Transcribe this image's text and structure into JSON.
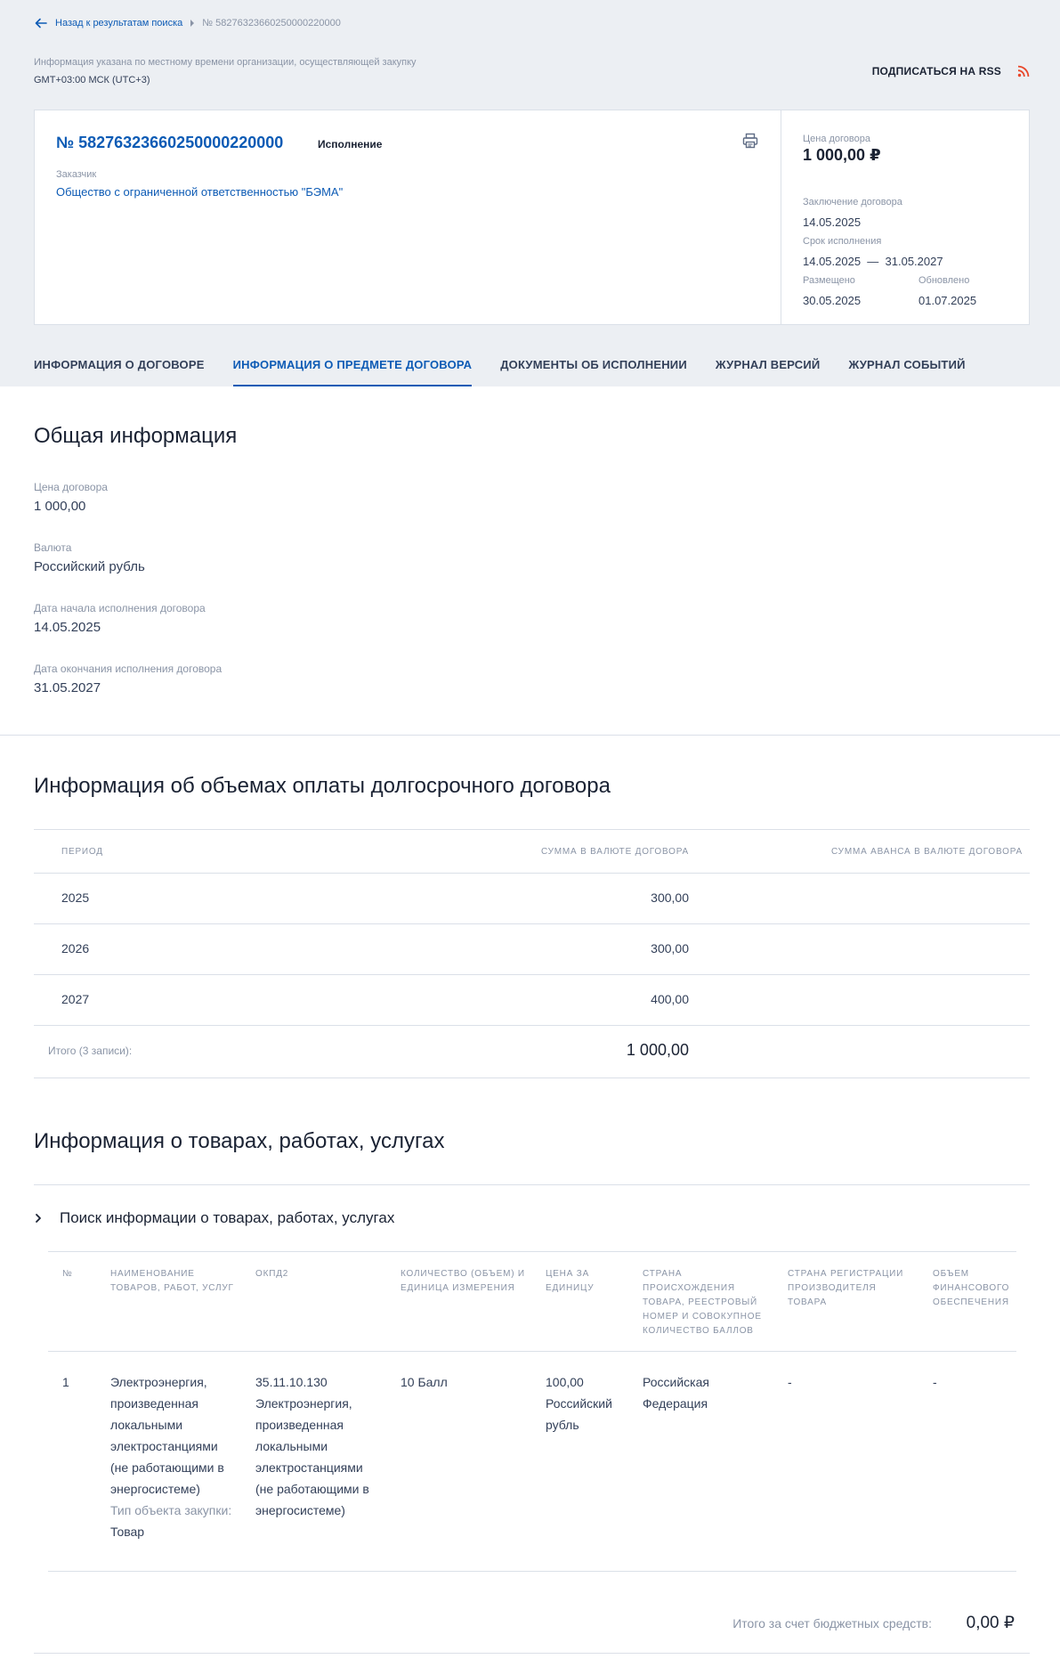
{
  "breadcrumb": {
    "back_label": "Назад к результатам поиска",
    "current": "№ 58276323660250000220000"
  },
  "timezone": {
    "note": "Информация указана по местному времени организации, осуществляющей закупку",
    "value": "GMT+03:00 МСК (UTC+3)"
  },
  "rss": {
    "label": "ПОДПИСАТЬСЯ НА RSS",
    "icon": "rss-icon"
  },
  "card": {
    "number": "№ 58276323660250000220000",
    "status": "Исполнение",
    "customer_label": "Заказчик",
    "customer_value": "Общество с ограниченной ответственностью \"БЭМА\"",
    "print_icon": "printer-icon",
    "price_label": "Цена договора",
    "price_value": "1 000,00 ₽",
    "conclusion_label": "Заключение договора",
    "conclusion_value": "14.05.2025",
    "term_label": "Срок исполнения",
    "term_value": "14.05.2025  —  31.05.2027",
    "posted_label": "Размещено",
    "posted_value": "30.05.2025",
    "updated_label": "Обновлено",
    "updated_value": "01.07.2025"
  },
  "tabs": [
    {
      "label": "ИНФОРМАЦИЯ О ДОГОВОРЕ",
      "active": false
    },
    {
      "label": "ИНФОРМАЦИЯ О ПРЕДМЕТЕ ДОГОВОРА",
      "active": true
    },
    {
      "label": "ДОКУМЕНТЫ ОБ ИСПОЛНЕНИИ",
      "active": false
    },
    {
      "label": "ЖУРНАЛ ВЕРСИЙ",
      "active": false
    },
    {
      "label": "ЖУРНАЛ СОБЫТИЙ",
      "active": false
    }
  ],
  "general": {
    "title": "Общая информация",
    "fields": [
      {
        "label": "Цена договора",
        "value": "1 000,00"
      },
      {
        "label": "Валюта",
        "value": "Российский рубль"
      },
      {
        "label": "Дата начала исполнения договора",
        "value": "14.05.2025"
      },
      {
        "label": "Дата окончания исполнения договора",
        "value": "31.05.2027"
      }
    ]
  },
  "payments": {
    "title": "Информация об объемах оплаты долгосрочного договора",
    "headers": [
      "ПЕРИОД",
      "СУММА В ВАЛЮТЕ ДОГОВОРА",
      "СУММА АВАНСА В ВАЛЮТЕ ДОГОВОРА"
    ],
    "rows": [
      {
        "period": "2025",
        "amount": "300,00",
        "advance": ""
      },
      {
        "period": "2026",
        "amount": "300,00",
        "advance": ""
      },
      {
        "period": "2027",
        "amount": "400,00",
        "advance": ""
      }
    ],
    "total_label": "Итого (3 записи):",
    "total_value": "1 000,00"
  },
  "goods": {
    "title": "Информация о товарах, работах, услугах",
    "search_label": "Поиск информации о товарах, работах, услугах",
    "headers": [
      "№",
      "НАИМЕНОВАНИЕ ТОВАРОВ, РАБОТ, УСЛУГ",
      "ОКПД2",
      "КОЛИЧЕСТВО (ОБЪЕМ) И ЕДИНИЦА ИЗМЕРЕНИЯ",
      "ЦЕНА ЗА ЕДИНИЦУ",
      "СТРАНА ПРОИСХОЖДЕНИЯ ТОВАРА, РЕЕСТРОВЫЙ НОМЕР И СОВОКУПНОЕ КОЛИЧЕСТВО БАЛЛОВ",
      "СТРАНА РЕГИСТРАЦИИ ПРОИЗВОДИТЕЛЯ ТОВАРА",
      "ОБЪЕМ ФИНАНСОВОГО ОБЕСПЕЧЕНИЯ"
    ],
    "row": {
      "num": "1",
      "name": "Электроэнергия, произведенная локальными электростанциями (не работающими в энергосистеме)",
      "type_label": "Тип объекта закупки:",
      "type_value": "Товар",
      "okpd": "35.11.10.130 Электроэнергия, произведенная локальными электростанциями (не работающими в энергосистеме)",
      "qty": "10 Балл",
      "price": "100,00 Российский рубль",
      "country": "Российская Федерация",
      "reg_country": "-",
      "finance": "-"
    },
    "budget_label": "Итого за счет бюджетных средств:",
    "budget_value": "0,00 ₽"
  }
}
